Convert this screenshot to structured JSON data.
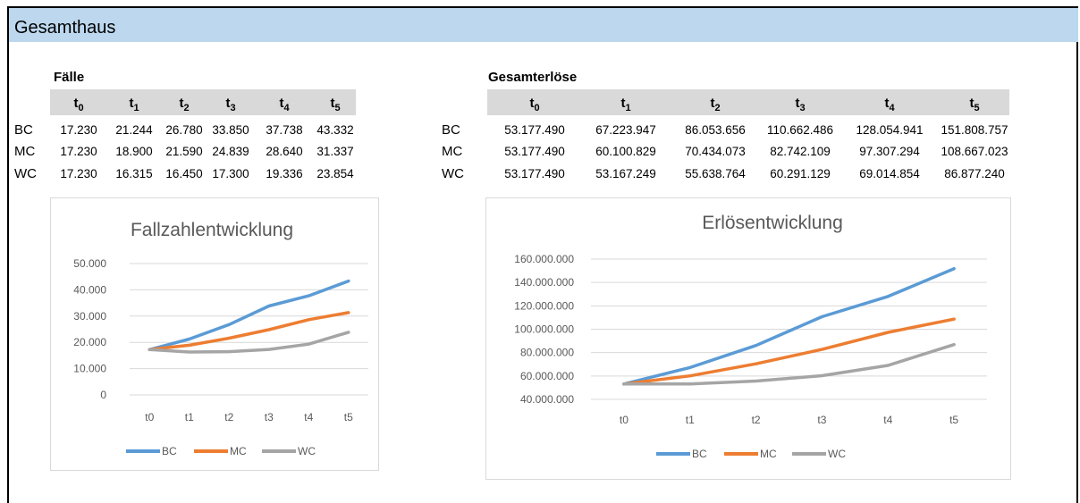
{
  "page": {
    "title": "Gesamthaus"
  },
  "tables": [
    {
      "title": "Fälle",
      "row_labels": [
        "BC",
        "MC",
        "WC"
      ],
      "rows": [
        [
          "17.230",
          "21.244",
          "26.780",
          "33.850",
          "37.738",
          "43.332"
        ],
        [
          "17.230",
          "18.900",
          "21.590",
          "24.839",
          "28.640",
          "31.337"
        ],
        [
          "17.230",
          "16.315",
          "16.450",
          "17.300",
          "19.336",
          "23.854"
        ]
      ]
    },
    {
      "title": "Gesamterlöse",
      "row_labels": [
        "BC",
        "MC",
        "WC"
      ],
      "rows": [
        [
          "53.177.490",
          "67.223.947",
          "86.053.656",
          "110.662.486",
          "128.054.941",
          "151.808.757"
        ],
        [
          "53.177.490",
          "60.100.829",
          "70.434.073",
          "82.742.109",
          "97.307.294",
          "108.667.023"
        ],
        [
          "53.177.490",
          "53.167.249",
          "55.638.764",
          "60.291.129",
          "69.014.854",
          "86.877.240"
        ]
      ]
    }
  ],
  "column_headers": [
    {
      "base": "t",
      "sub": "0"
    },
    {
      "base": "t",
      "sub": "1"
    },
    {
      "base": "t",
      "sub": "2"
    },
    {
      "base": "t",
      "sub": "3"
    },
    {
      "base": "t",
      "sub": "4"
    },
    {
      "base": "t",
      "sub": "5"
    }
  ],
  "colors": {
    "BC": "#5b9bd5",
    "MC": "#ed7d31",
    "WC": "#a5a5a5",
    "header_band": "#d9d9d9",
    "title_bar": "#bdd7ee"
  },
  "chart_data": [
    {
      "type": "line",
      "title": "Fallzahlentwicklung",
      "x": [
        "t0",
        "t1",
        "t2",
        "t3",
        "t4",
        "t5"
      ],
      "ylim": [
        0,
        50000
      ],
      "yticks": [
        0,
        10000,
        20000,
        30000,
        40000,
        50000
      ],
      "ytick_labels": [
        "0",
        "10.000",
        "20.000",
        "30.000",
        "40.000",
        "50.000"
      ],
      "grid": true,
      "legend": "bottom",
      "series": [
        {
          "name": "BC",
          "values": [
            17230,
            21244,
            26780,
            33850,
            37738,
            43332
          ]
        },
        {
          "name": "MC",
          "values": [
            17230,
            18900,
            21590,
            24839,
            28640,
            31337
          ]
        },
        {
          "name": "WC",
          "values": [
            17230,
            16315,
            16450,
            17300,
            19336,
            23854
          ]
        }
      ]
    },
    {
      "type": "line",
      "title": "Erlösentwicklung",
      "x": [
        "t0",
        "t1",
        "t2",
        "t3",
        "t4",
        "t5"
      ],
      "ylim": [
        40000000,
        160000000
      ],
      "yticks": [
        40000000,
        60000000,
        80000000,
        100000000,
        120000000,
        140000000,
        160000000
      ],
      "ytick_labels": [
        "40.000.000",
        "60.000.000",
        "80.000.000",
        "100.000.000",
        "120.000.000",
        "140.000.000",
        "160.000.000"
      ],
      "grid": true,
      "legend": "bottom",
      "series": [
        {
          "name": "BC",
          "values": [
            53177490,
            67223947,
            86053656,
            110662486,
            128054941,
            151808757
          ]
        },
        {
          "name": "MC",
          "values": [
            53177490,
            60100829,
            70434073,
            82742109,
            97307294,
            108667023
          ]
        },
        {
          "name": "WC",
          "values": [
            53177490,
            53167249,
            55638764,
            60291129,
            69014854,
            86877240
          ]
        }
      ]
    }
  ]
}
